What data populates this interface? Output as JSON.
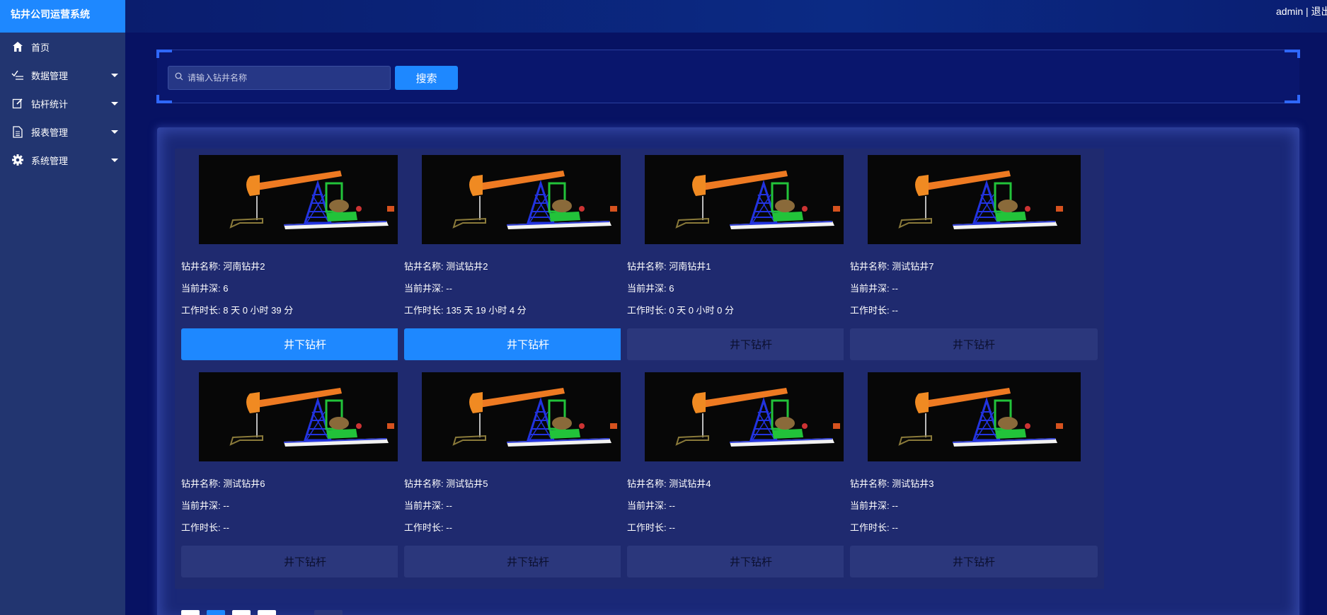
{
  "app": {
    "title": "钻井公司运营系统"
  },
  "header": {
    "user": "admin",
    "separator": " | ",
    "logout": "退出"
  },
  "sidebar": {
    "items": [
      {
        "label": "首页",
        "icon": "home-icon"
      },
      {
        "label": "数据管理",
        "icon": "chart-check-icon"
      },
      {
        "label": "钻杆统计",
        "icon": "edit-icon"
      },
      {
        "label": "报表管理",
        "icon": "document-icon"
      },
      {
        "label": "系统管理",
        "icon": "gear-icon"
      }
    ]
  },
  "search": {
    "placeholder": "请输入钻井名称",
    "button": "搜索"
  },
  "cards": [
    {
      "name_label": "钻井名称: ",
      "name": "河南钻井2",
      "depth_label": "当前井深: ",
      "depth": "6",
      "time_label": "工作时长: ",
      "time": "8 天 0 小时 39 分",
      "button": "井下钻杆",
      "active": true
    },
    {
      "name_label": "钻井名称: ",
      "name": "测试钻井2",
      "depth_label": "当前井深: ",
      "depth": "--",
      "time_label": "工作时长: ",
      "time": "135 天 19 小时 4 分",
      "button": "井下钻杆",
      "active": true
    },
    {
      "name_label": "钻井名称: ",
      "name": "河南钻井1",
      "depth_label": "当前井深: ",
      "depth": "6",
      "time_label": "工作时长: ",
      "time": "0 天 0 小时 0 分",
      "button": "井下钻杆",
      "active": false
    },
    {
      "name_label": "钻井名称: ",
      "name": "测试钻井7",
      "depth_label": "当前井深: ",
      "depth": "--",
      "time_label": "工作时长: ",
      "time": "--",
      "button": "井下钻杆",
      "active": false
    },
    {
      "name_label": "钻井名称: ",
      "name": "测试钻井6",
      "depth_label": "当前井深: ",
      "depth": "--",
      "time_label": "工作时长: ",
      "time": "--",
      "button": "井下钻杆",
      "active": false
    },
    {
      "name_label": "钻井名称: ",
      "name": "测试钻井5",
      "depth_label": "当前井深: ",
      "depth": "--",
      "time_label": "工作时长: ",
      "time": "--",
      "button": "井下钻杆",
      "active": false
    },
    {
      "name_label": "钻井名称: ",
      "name": "测试钻井4",
      "depth_label": "当前井深: ",
      "depth": "--",
      "time_label": "工作时长: ",
      "time": "--",
      "button": "井下钻杆",
      "active": false
    },
    {
      "name_label": "钻井名称: ",
      "name": "测试钻井3",
      "depth_label": "当前井深: ",
      "depth": "--",
      "time_label": "工作时长: ",
      "time": "--",
      "button": "井下钻杆",
      "active": false
    }
  ],
  "colors": {
    "accent": "#1e88ff",
    "background": "#071263",
    "sidebar": "#223570",
    "card": "#1f2a6f"
  }
}
